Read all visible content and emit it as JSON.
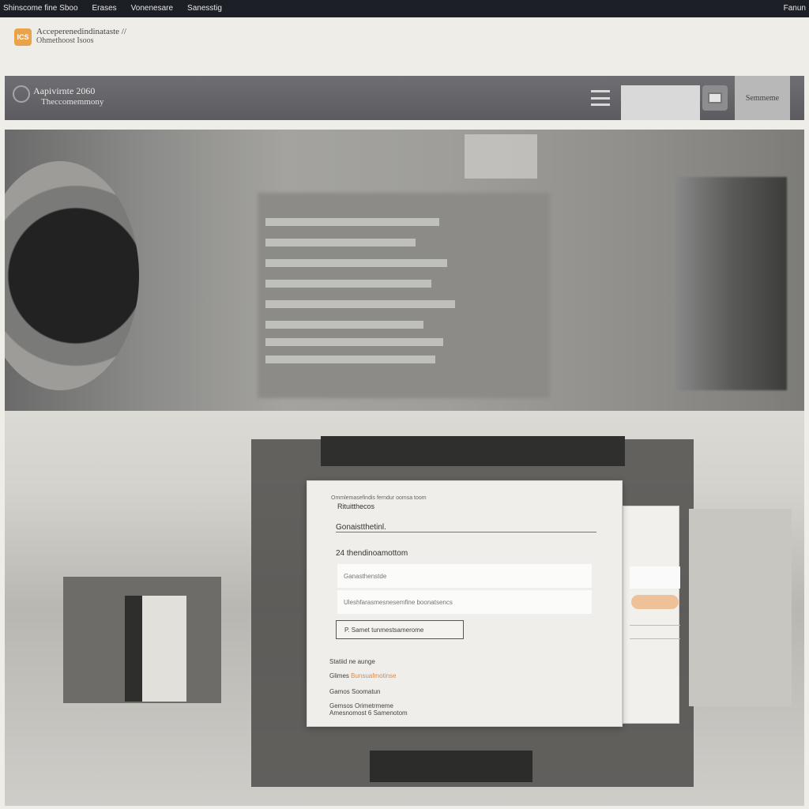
{
  "topbar": {
    "nav": [
      "Shinscome fine Sboo",
      "Erases",
      "Vonenesare",
      "Sanesstig"
    ],
    "right": "Fanun"
  },
  "brand": {
    "logo_text": "ICS",
    "line1": "Acceperenedindinataste //",
    "line2": "Ohmethoost Isoos"
  },
  "band": {
    "title": "Aapivirnte 2060",
    "subtitle": "Theccomemmony",
    "button": "Semmeme"
  },
  "dialog": {
    "header_small": "Ommlemasefindis ferndur oomsa toom",
    "header_title": "Rituitthecos",
    "section_title": "Gonaistthetinl.",
    "field_title": "24 thendinoamottom",
    "input1_placeholder": "Ganasthenstde",
    "input2_placeholder": "Uleshfarasmesnesemfine boonatsencs",
    "action_button": "P. Samet tunmestsamerome",
    "link1": "Statiid ne aunge",
    "link2_prefix": "Glimes",
    "link2_accent": "Bunsuafmotinse",
    "link3": "Gamos Soomatun",
    "footer1": "Gemsos Orimetrmeme",
    "footer2": "Amesnomost 6 Samenotom"
  },
  "colors": {
    "accent": "#e08a44",
    "topbar": "#1c1f26",
    "band": "#606064"
  }
}
